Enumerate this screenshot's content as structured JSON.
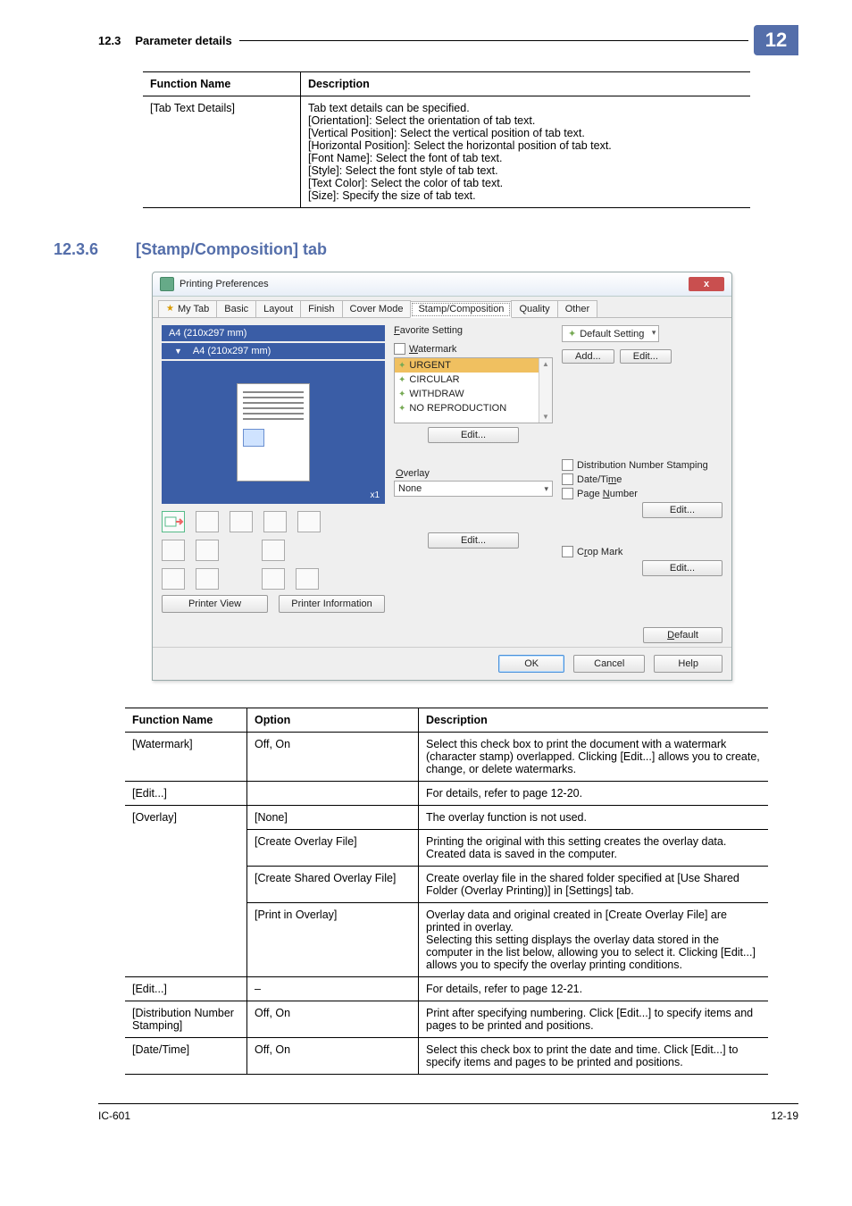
{
  "header": {
    "section_number": "12.3",
    "section_title": "Parameter details",
    "chapter": "12"
  },
  "table1": {
    "headers": [
      "Function Name",
      "Description"
    ],
    "row": {
      "fn": "[Tab Text Details]",
      "lines": [
        "Tab text details can be specified.",
        "[Orientation]: Select the orientation of tab text.",
        "[Vertical Position]: Select the vertical position of tab text.",
        "[Horizontal Position]: Select the horizontal position of tab text.",
        "[Font Name]: Select the font of tab text.",
        "[Style]: Select the font style of tab text.",
        "[Text Color]: Select the color of tab text.",
        "[Size]: Specify the size of tab text."
      ]
    }
  },
  "subsection": {
    "number": "12.3.6",
    "title": "[Stamp/Composition] tab"
  },
  "dialog": {
    "title": "Printing Preferences",
    "close_x": "x",
    "tabs": {
      "mytab": "My Tab",
      "basic": "Basic",
      "layout": "Layout",
      "finish": "Finish",
      "cover": "Cover Mode",
      "stamp": "Stamp/Composition",
      "quality": "Quality",
      "other": "Other"
    },
    "paper_a": "A4 (210x297 mm)",
    "paper_b": "A4 (210x297 mm)",
    "xcount": "x1",
    "printer_view": "Printer View",
    "printer_info": "Printer Information",
    "fav_label": "Favorite Setting",
    "fav_value": "Default Setting",
    "add_btn": "Add...",
    "edit_top_btn": "Edit...",
    "watermark_label": "Watermark",
    "wm_items": {
      "urgent": "URGENT",
      "circular": "CIRCULAR",
      "withdraw": "WITHDRAW",
      "norepro": "NO REPRODUCTION"
    },
    "edit_btn": "Edit...",
    "overlay_label": "Overlay",
    "overlay_value": "None",
    "dist_label": "Distribution Number Stamping",
    "datetime_label": "Date/Time",
    "pagenum_label": "Page Number",
    "crop_label": "Crop Mark",
    "default_btn": "Default",
    "ok_btn": "OK",
    "cancel_btn": "Cancel",
    "help_btn": "Help"
  },
  "table2": {
    "headers": [
      "Function Name",
      "Option",
      "Description"
    ],
    "rows": [
      {
        "fn": "[Watermark]",
        "opt": "Off, On",
        "desc": "Select this check box to print the document with a watermark (character stamp) overlapped. Clicking [Edit...] allows you to create, change, or delete watermarks."
      },
      {
        "fn": "[Edit...]",
        "opt": "",
        "desc": "For details, refer to page 12-20."
      },
      {
        "fn": "[Overlay]",
        "sub": [
          {
            "opt": "[None]",
            "desc": "The overlay function is not used."
          },
          {
            "opt": "[Create Overlay File]",
            "desc": "Printing the original with this setting creates the overlay data. Created data is saved in the computer."
          },
          {
            "opt": "[Create Shared Overlay File]",
            "desc": "Create overlay file in the shared folder specified at [Use Shared Folder (Overlay Printing)] in [Settings] tab."
          },
          {
            "opt": "[Print in Overlay]",
            "desc": "Overlay data and original created in [Create Overlay File] are printed in overlay.\nSelecting this setting displays the overlay data stored in the computer in the list below, allowing you to select it. Clicking [Edit...] allows you to specify the overlay printing conditions."
          }
        ]
      },
      {
        "fn": "[Edit...]",
        "opt": "–",
        "desc": "For details, refer to page 12-21."
      },
      {
        "fn": "[Distribution Number Stamping]",
        "opt": "Off, On",
        "desc": "Print after specifying numbering. Click [Edit...] to specify items and pages to be printed and positions."
      },
      {
        "fn": "[Date/Time]",
        "opt": "Off, On",
        "desc": "Select this check box to print the date and time. Click [Edit...] to specify items and pages to be printed and positions."
      }
    ]
  },
  "footer": {
    "product": "IC-601",
    "page": "12-19"
  }
}
